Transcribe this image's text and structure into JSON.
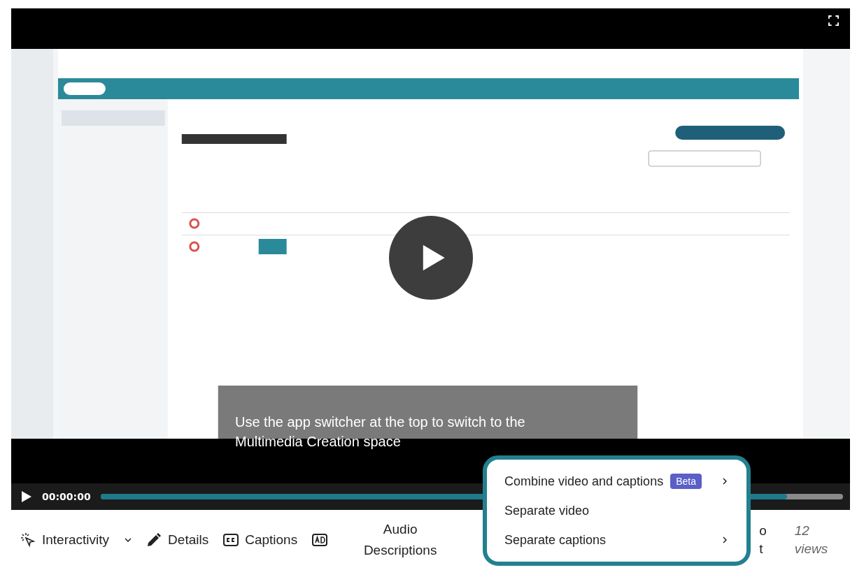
{
  "player": {
    "caption_lines": [
      "Use the app switcher at the top to switch to the",
      "Multimedia Creation space"
    ],
    "time": "00:00:00",
    "progress": {
      "level": 0.925
    }
  },
  "toolbar": [
    {
      "kind": "interactivity",
      "label": "Interactivity"
    },
    {
      "kind": "details",
      "label": "Details"
    },
    {
      "kind": "captions",
      "label": "Captions"
    },
    {
      "kind": "ad",
      "label": "Audio Descriptions"
    }
  ],
  "partial_item": {
    "lines": [
      "o",
      "t"
    ]
  },
  "views": "12 views",
  "menu": {
    "items": [
      {
        "label": "Combine video and captions",
        "badge": "Beta",
        "submenu": true
      },
      {
        "label": "Separate video",
        "submenu": false
      },
      {
        "label": "Separate captions",
        "submenu": true
      }
    ]
  }
}
